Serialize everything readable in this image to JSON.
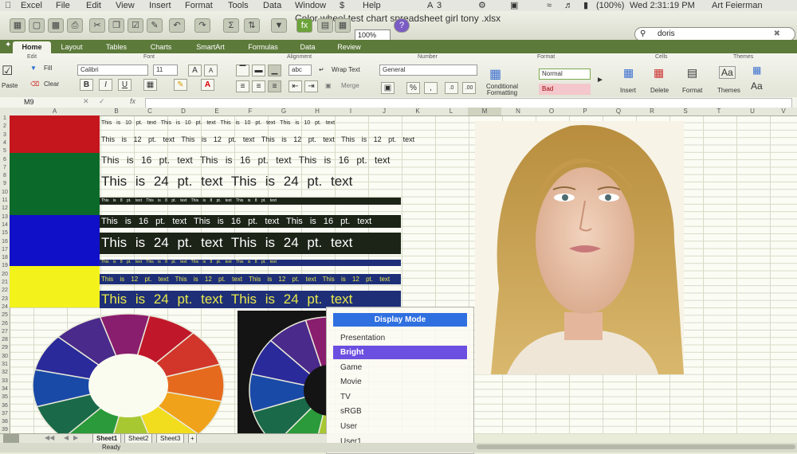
{
  "menubar": {
    "items": [
      "Excel",
      "File",
      "Edit",
      "View",
      "Insert",
      "Format",
      "Tools",
      "Data",
      "Window",
      "Help"
    ],
    "battery": "(100%)",
    "clock": "Wed 2:31:19 PM",
    "user": "Art Feierman",
    "badge": "3"
  },
  "window": {
    "filename": "Color wheel test chart spreadsheet girl tony .xlsx"
  },
  "toolbar": {
    "zoom": "100%",
    "search_value": "doris"
  },
  "ribbon": {
    "tabs": [
      "Home",
      "Layout",
      "Tables",
      "Charts",
      "SmartArt",
      "Formulas",
      "Data",
      "Review"
    ],
    "groups": {
      "edit": "Edit",
      "font": "Font",
      "alignment": "Alignment",
      "number": "Number",
      "format": "Format",
      "cells": "Cells",
      "themes": "Themes"
    },
    "paste": "Paste",
    "fill": "Fill",
    "clear": "Clear",
    "font_name": "Calibri",
    "font_size": "11",
    "bold": "B",
    "italic": "I",
    "underline": "U",
    "abc": "abc",
    "wrap_text": "Wrap Text",
    "merge": "Merge",
    "number_format": "General",
    "conditional_formatting": "Conditional Formatting",
    "style_normal": "Normal",
    "style_bad": "Bad",
    "insert": "Insert",
    "delete": "Delete",
    "format": "Format",
    "themes": "Themes",
    "aa": "Aa"
  },
  "formula_bar": {
    "cell_ref": "M9",
    "fx": "fx",
    "value": ""
  },
  "columns": [
    "A",
    "B",
    "C",
    "D",
    "E",
    "F",
    "G",
    "H",
    "I",
    "J",
    "K",
    "L",
    "M",
    "N",
    "O",
    "P",
    "Q",
    "R",
    "S",
    "T",
    "U",
    "V"
  ],
  "sheet_text": {
    "t10": "This is 10 pt. text  This is 10 pt. text  This is 10 pt. text  This is 10 pt. text",
    "t12": "This is 12 pt. text  This is 12 pt. text  This is 12 pt. text  This is 12 pt. text",
    "t16": "This is 16 pt. text  This is 16 pt. text  This is 16 pt. text",
    "t24": "This is 24 pt. text  This is 24 pt. text",
    "t8": "This is 8 pt. text  This is 8 pt. text  This is 8 pt. text  This is 8 pt. text",
    "t16b": "This is 16 pt. text  This is 16 pt. text  This is 16 pt. text",
    "t24b": "This is 24 pt. text  This is 24 pt. text",
    "t8b": "This is 8 pt. text  This is 8 pt. text  This is 8 pt. text  This is 8 pt. text",
    "t12b": "This is 12 pt. text  This is 12 pt. text  This is 12 pt. text  This is 12 pt. text",
    "t24c": "This is 24 pt. text  This is 24 pt. text"
  },
  "colors": {
    "red": "#c4161c",
    "green": "#0b6a2a",
    "blue": "#1010c8",
    "yellow": "#f3f21a",
    "band_dark": "#1c2418",
    "band_blue": "#1e2f78",
    "text_yellow": "#e8e84a"
  },
  "popup": {
    "title": "Display Mode",
    "options": [
      "Presentation",
      "Bright",
      "Game",
      "Movie",
      "TV",
      "sRGB",
      "User",
      "User1"
    ],
    "selected": "Bright"
  },
  "sheet_tabs": [
    "Sheet1",
    "Sheet2",
    "Sheet3",
    "+"
  ],
  "status": {
    "text": "Ready"
  }
}
